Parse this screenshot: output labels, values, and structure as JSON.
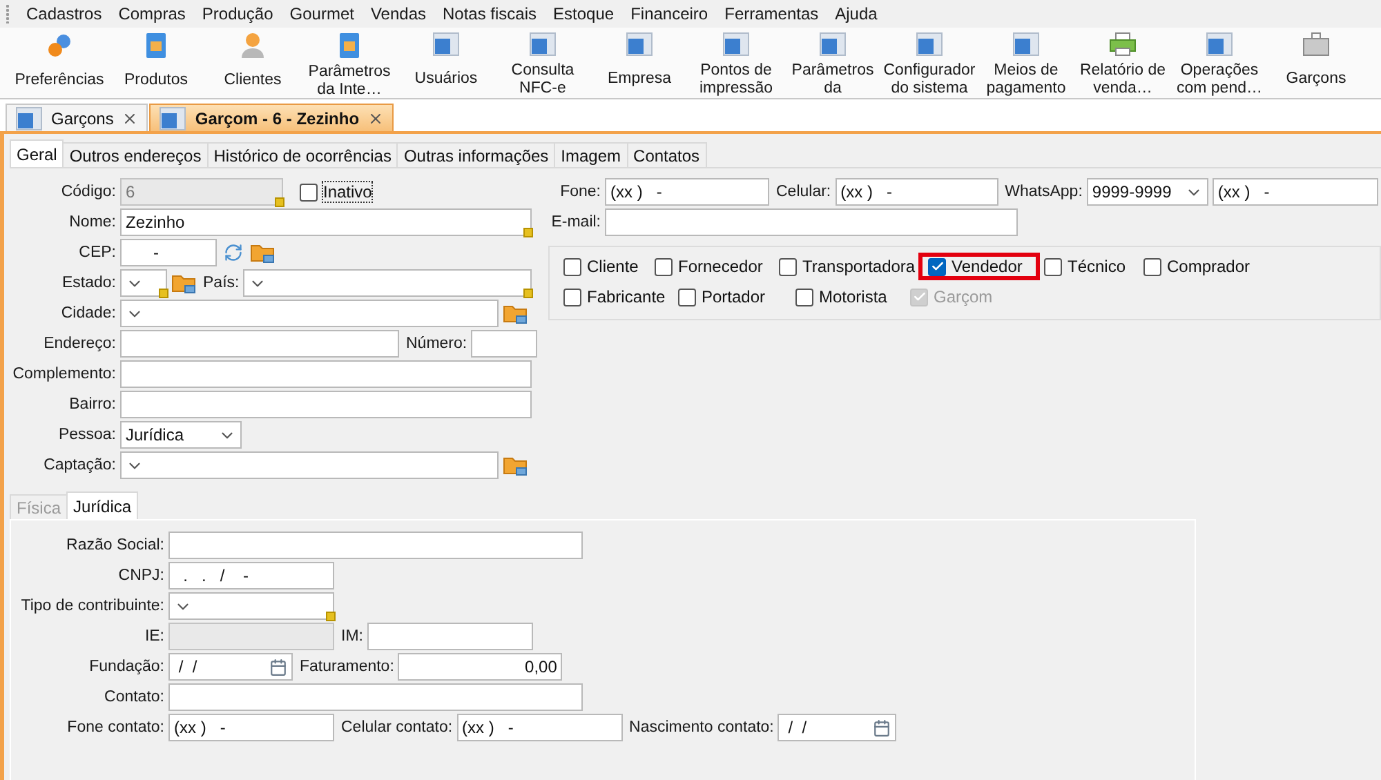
{
  "menu": [
    "Cadastros",
    "Compras",
    "Produção",
    "Gourmet",
    "Vendas",
    "Notas fiscais",
    "Estoque",
    "Financeiro",
    "Ferramentas",
    "Ajuda"
  ],
  "toolbar": [
    {
      "label": "Preferências",
      "kind": "gears"
    },
    {
      "label": "Produtos",
      "kind": "book"
    },
    {
      "label": "Clientes",
      "kind": "person"
    },
    {
      "label": "Parâmetros\nda Inte…",
      "kind": "book"
    },
    {
      "label": "Usuários",
      "kind": "window"
    },
    {
      "label": "Consulta\nNFC-e",
      "kind": "window"
    },
    {
      "label": "Empresa",
      "kind": "window"
    },
    {
      "label": "Pontos de\nimpressão",
      "kind": "window"
    },
    {
      "label": "Parâmetros\nda",
      "kind": "window"
    },
    {
      "label": "Configurador\ndo sistema",
      "kind": "window"
    },
    {
      "label": "Meios de\npagamento",
      "kind": "window"
    },
    {
      "label": "Relatório de\nvenda…",
      "kind": "printer"
    },
    {
      "label": "Operações\ncom pend…",
      "kind": "window"
    },
    {
      "label": "Garçons",
      "kind": "case"
    }
  ],
  "documents": [
    {
      "title": "Garçons",
      "selected": false
    },
    {
      "title": "Garçom - 6 - Zezinho",
      "selected": true
    }
  ],
  "tabs": [
    {
      "label": "Geral",
      "selected": true
    },
    {
      "label": "Outros endereços",
      "selected": false
    },
    {
      "label": "Histórico de ocorrências",
      "selected": false
    },
    {
      "label": "Outras informações",
      "selected": false
    },
    {
      "label": "Imagem",
      "selected": false
    },
    {
      "label": "Contatos",
      "selected": false
    }
  ],
  "general_rows": [
    [
      {
        "label": "Código:",
        "kind": "text",
        "value": "6",
        "disabled": true,
        "required": true
      },
      {
        "kind": "checkbox",
        "label": "Inativo",
        "checked": false,
        "focused": true
      }
    ],
    [
      {
        "label": "Nome:",
        "kind": "text",
        "value": "Zezinho",
        "disabled": false,
        "required": true
      }
    ],
    [
      {
        "label": "CEP:",
        "kind": "text",
        "value": "      -",
        "disabled": false,
        "required": false,
        "refresh": true,
        "lookup": true
      }
    ],
    [
      {
        "label": "Estado:",
        "kind": "select",
        "disabled": false,
        "required": true,
        "lookup": true
      },
      {
        "label": "País:",
        "kind": "select",
        "disabled": false,
        "required": true
      }
    ],
    [
      {
        "label": "Cidade:",
        "kind": "select",
        "disabled": false,
        "required": false,
        "lookup": true
      }
    ],
    [
      {
        "label": "Endereço:",
        "kind": "text",
        "disabled": false,
        "required": false
      },
      {
        "label": "Número:",
        "kind": "text",
        "disabled": false,
        "required": false
      }
    ],
    [
      {
        "label": "Complemento:",
        "kind": "text",
        "disabled": false,
        "required": false
      }
    ],
    [
      {
        "label": "Bairro:",
        "kind": "text",
        "disabled": false,
        "required": false
      }
    ],
    [
      {
        "label": "Pessoa:",
        "kind": "select",
        "value": "Jurídica",
        "disabled": false,
        "required": false
      }
    ],
    [
      {
        "label": "Captação:",
        "kind": "select",
        "disabled": false,
        "required": false,
        "lookup": true
      }
    ]
  ],
  "contact_rows": [
    [
      {
        "label": "Fone:",
        "kind": "text",
        "value": "(xx )   -",
        "disabled": false,
        "required": false
      },
      {
        "label": "Celular:",
        "kind": "text",
        "value": "(xx )   -",
        "disabled": false,
        "required": false
      },
      {
        "label": "WhatsApp:",
        "kind": "select",
        "value": "9999-9999",
        "disabled": false,
        "required": false
      },
      {
        "kind": "text",
        "value": "(xx )   -",
        "disabled": false,
        "required": false
      }
    ],
    [
      {
        "label": "E-mail:",
        "kind": "text",
        "disabled": false,
        "required": false
      }
    ]
  ],
  "roles": [
    [
      {
        "label": "Cliente",
        "checked": false,
        "disabled": false,
        "highlighted": false
      },
      {
        "label": "Fornecedor",
        "checked": false,
        "disabled": false,
        "highlighted": false
      },
      {
        "label": "Transportadora",
        "checked": false,
        "disabled": false,
        "highlighted": false
      },
      {
        "label": "Vendedor",
        "checked": true,
        "disabled": false,
        "highlighted": true
      },
      {
        "label": "Técnico",
        "checked": false,
        "disabled": false,
        "highlighted": false
      },
      {
        "label": "Comprador",
        "checked": false,
        "disabled": false,
        "highlighted": false
      }
    ],
    [
      {
        "label": "Fabricante",
        "checked": false,
        "disabled": false,
        "highlighted": false
      },
      {
        "label": "Portador",
        "checked": false,
        "disabled": false,
        "highlighted": false
      },
      {
        "label": "Motorista",
        "checked": false,
        "disabled": false,
        "highlighted": false
      },
      {
        "label": "Garçom",
        "checked": true,
        "disabled": true,
        "highlighted": false
      }
    ]
  ],
  "person_tabs": [
    {
      "label": "Física",
      "selected": false
    },
    {
      "label": "Jurídica",
      "selected": true
    }
  ],
  "company_rows": [
    [
      {
        "label": "Razão Social:",
        "kind": "text",
        "disabled": false,
        "required": false
      }
    ],
    [
      {
        "label": "CNPJ:",
        "kind": "text",
        "value": "  .   .   /    -",
        "disabled": false,
        "required": false
      }
    ],
    [
      {
        "label": "Tipo de contribuinte:",
        "kind": "select",
        "disabled": false,
        "required": true
      }
    ],
    [
      {
        "label": "IE:",
        "kind": "text",
        "disabled": true,
        "required": false
      },
      {
        "label": "IM:",
        "kind": "text",
        "disabled": false,
        "required": false
      }
    ],
    [
      {
        "label": "Fundação:",
        "kind": "date",
        "value": " /  /",
        "disabled": false,
        "required": false
      },
      {
        "label": "Faturamento:",
        "kind": "number",
        "value": "0,00",
        "disabled": false,
        "required": false
      }
    ],
    [
      {
        "label": "Contato:",
        "kind": "text",
        "disabled": false,
        "required": false
      }
    ],
    [
      {
        "label": "Fone contato:",
        "kind": "text",
        "value": "(xx )   -",
        "disabled": false,
        "required": false
      },
      {
        "label": "Celular contato:",
        "kind": "text",
        "value": "(xx )   -",
        "disabled": false,
        "required": false
      },
      {
        "label": "Nascimento contato:",
        "kind": "date",
        "value": " /  /",
        "disabled": false,
        "required": false
      }
    ]
  ]
}
